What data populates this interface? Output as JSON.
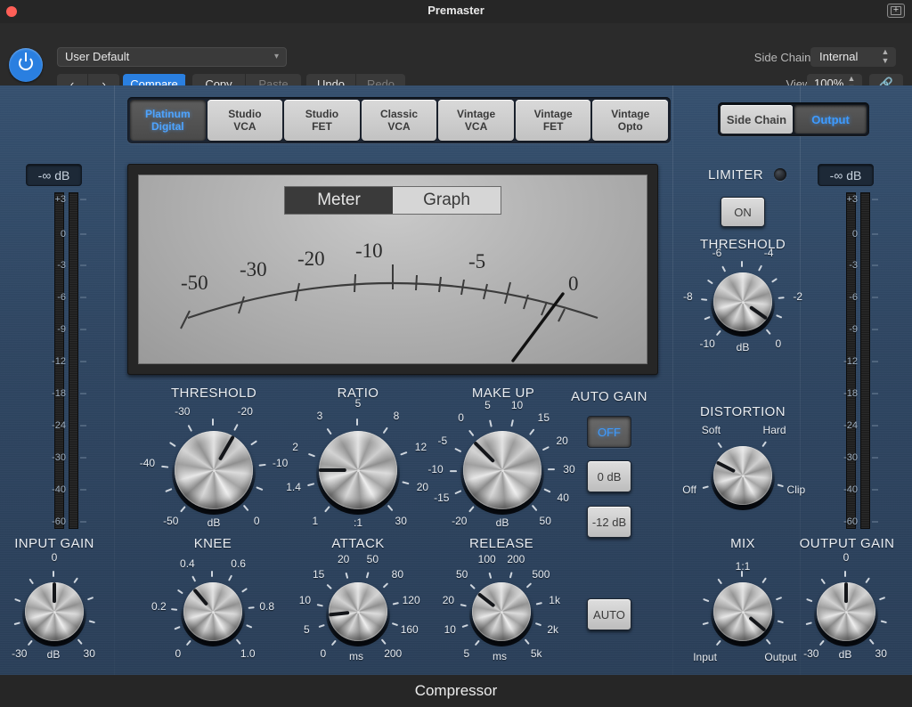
{
  "window": {
    "title": "Premaster",
    "close_icon": "close-dot-icon",
    "expand_icon": "expand-window-icon"
  },
  "header": {
    "power_icon": "power-icon",
    "preset": {
      "value": "User Default",
      "chevron": "chevron-down-icon"
    },
    "nav": {
      "prev": "‹",
      "next": "›"
    },
    "compare": "Compare",
    "copy": "Copy",
    "paste": "Paste",
    "undo": "Undo",
    "redo": "Redo",
    "side_chain_label": "Side Chain:",
    "side_chain_value": "Internal",
    "view_label": "View:",
    "view_value": "100%",
    "link_icon": "link-icon",
    "stepper_icon": "stepper-updown-icon"
  },
  "models": {
    "items": [
      {
        "line1": "Platinum",
        "line2": "Digital",
        "active": true
      },
      {
        "line1": "Studio",
        "line2": "VCA",
        "active": false
      },
      {
        "line1": "Studio",
        "line2": "FET",
        "active": false
      },
      {
        "line1": "Classic",
        "line2": "VCA",
        "active": false
      },
      {
        "line1": "Vintage",
        "line2": "VCA",
        "active": false
      },
      {
        "line1": "Vintage",
        "line2": "FET",
        "active": false
      },
      {
        "line1": "Vintage",
        "line2": "Opto",
        "active": false
      }
    ]
  },
  "scout": {
    "side_chain": "Side Chain",
    "output": "Output",
    "selected": "Output"
  },
  "display": {
    "meter_tab": "Meter",
    "graph_tab": "Graph",
    "selected_tab": "Graph",
    "vu_labels": [
      "-50",
      "-30",
      "-20",
      "-10",
      "-5",
      "0"
    ],
    "needle_value": 0
  },
  "input_meter": {
    "readout": "-∞ dB",
    "scale": [
      "+3",
      "0",
      "-3",
      "-6",
      "-9",
      "-12",
      "-18",
      "-24",
      "-30",
      "-40",
      "-60"
    ],
    "level_db": null
  },
  "output_meter": {
    "readout": "-∞ dB",
    "scale": [
      "+3",
      "0",
      "-3",
      "-6",
      "-9",
      "-12",
      "-18",
      "-24",
      "-30",
      "-40",
      "-60"
    ],
    "level_db": null
  },
  "knobs": {
    "threshold": {
      "title": "THRESHOLD",
      "unit": "dB",
      "labels": [
        "-50",
        "-40",
        "-30",
        "-20",
        "-10",
        "0"
      ],
      "angle": 30
    },
    "ratio": {
      "title": "RATIO",
      "unit": ":1",
      "labels": [
        "1",
        "1.4",
        "2",
        "3",
        "5",
        "8",
        "12",
        "20",
        "30"
      ],
      "angle": -90
    },
    "makeup": {
      "title": "MAKE UP",
      "unit": "dB",
      "labels": [
        "-20",
        "-15",
        "-10",
        "-5",
        "0",
        "5",
        "10",
        "15",
        "20",
        "30",
        "40",
        "50"
      ],
      "angle": -45
    },
    "knee": {
      "title": "KNEE",
      "unit": "",
      "labels": [
        "0",
        "0.2",
        "0.4",
        "0.6",
        "0.8",
        "1.0"
      ],
      "angle": -40
    },
    "attack": {
      "title": "ATTACK",
      "unit": "ms",
      "labels": [
        "0",
        "5",
        "10",
        "15",
        "20",
        "50",
        "80",
        "120",
        "160",
        "200"
      ],
      "angle": -96
    },
    "release": {
      "title": "RELEASE",
      "unit": "ms",
      "labels": [
        "5",
        "10",
        "20",
        "50",
        "100",
        "200",
        "500",
        "1k",
        "2k",
        "5k"
      ],
      "angle": -52
    },
    "input_gain": {
      "title": "INPUT GAIN",
      "unit": "dB",
      "labels": [
        "-30",
        "0",
        "30"
      ],
      "angle": 0
    },
    "output_gain": {
      "title": "OUTPUT GAIN",
      "unit": "dB",
      "labels": [
        "-30",
        "0",
        "30"
      ],
      "angle": 0
    },
    "limiter_threshold": {
      "title": "THRESHOLD",
      "unit": "dB",
      "labels": [
        "-10",
        "-8",
        "-6",
        "-4",
        "-2",
        "0"
      ],
      "angle": 125
    },
    "distortion": {
      "title": "DISTORTION",
      "unit": "",
      "labels": [
        "Off",
        "Soft",
        "Hard",
        "Clip"
      ],
      "angle": -63
    },
    "mix": {
      "title": "MIX",
      "unit": "1:1",
      "labels": [
        "Input",
        "Output"
      ],
      "angle": 130
    }
  },
  "auto_gain": {
    "title": "AUTO GAIN",
    "options": [
      {
        "label": "OFF",
        "active": true
      },
      {
        "label": "0 dB",
        "active": false
      },
      {
        "label": "-12 dB",
        "active": false
      }
    ],
    "auto_button": "AUTO"
  },
  "limiter": {
    "title": "LIMITER",
    "led_icon": "limiter-led-icon",
    "on_button": "ON",
    "on_active": false
  },
  "footer": {
    "plugin_name": "Compressor"
  },
  "colors": {
    "panel_blue": "#2e4561",
    "accent_blue": "#2a7fe0",
    "led_blue": "#3e9bff",
    "close_red": "#ff5f57"
  }
}
